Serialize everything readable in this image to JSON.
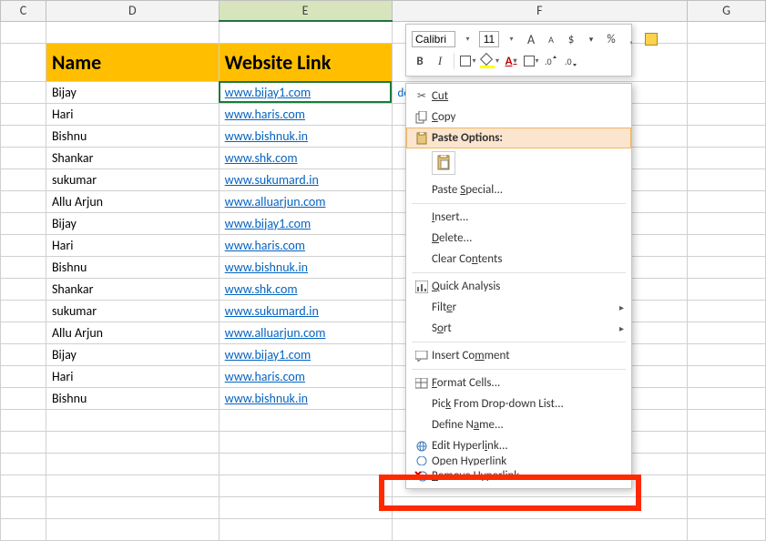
{
  "columns": {
    "C": "C",
    "D": "D",
    "E": "E",
    "F": "F",
    "G": "G"
  },
  "headers": {
    "name": "Name",
    "link": "Website Link"
  },
  "rows": [
    {
      "name": "Bijay",
      "link": "www.bijay1.com"
    },
    {
      "name": "Hari",
      "link": "www.haris.com"
    },
    {
      "name": "Bishnu",
      "link": "www.bishnuk.in"
    },
    {
      "name": "Shankar",
      "link": "www.shk.com"
    },
    {
      "name": "sukumar",
      "link": "www.sukumard.in"
    },
    {
      "name": "Allu Arjun",
      "link": "www.alluarjun.com"
    },
    {
      "name": "Bijay",
      "link": "www.bijay1.com"
    },
    {
      "name": "Hari",
      "link": "www.haris.com"
    },
    {
      "name": "Bishnu",
      "link": "www.bishnuk.in"
    },
    {
      "name": "Shankar",
      "link": "www.shk.com"
    },
    {
      "name": "sukumar",
      "link": "www.sukumard.in"
    },
    {
      "name": "Allu Arjun",
      "link": "www.alluarjun.com"
    },
    {
      "name": "Bijay",
      "link": "www.bijay1.com"
    },
    {
      "name": "Hari",
      "link": "www.haris.com"
    },
    {
      "name": "Bishnu",
      "link": "www.bishnuk.in"
    }
  ],
  "partialText": "dearbijay@gmail.com",
  "miniToolbar": {
    "font": "Calibri",
    "size": "11",
    "increaseFont": "A",
    "decreaseFont": "A",
    "currency": "$",
    "percent": "%",
    "comma": ",",
    "bold": "B",
    "italic": "I"
  },
  "ctx": {
    "cut": "Cut",
    "copy": "Copy",
    "pasteOptions": "Paste Options:",
    "pasteSpecial": "Paste Special...",
    "insert": "Insert...",
    "delete": "Delete...",
    "clearContents": "Clear Contents",
    "quickAnalysis": "Quick Analysis",
    "filter": "Filter",
    "sort": "Sort",
    "insertComment": "Insert Comment",
    "formatCells": "Format Cells...",
    "pickList": "Pick From Drop-down List...",
    "defineName": "Define Name...",
    "editHyperlink": "Edit Hyperlink...",
    "openHyperlink": "Open Hyperlink",
    "removeHyperlink": "Remove Hyperlink"
  }
}
